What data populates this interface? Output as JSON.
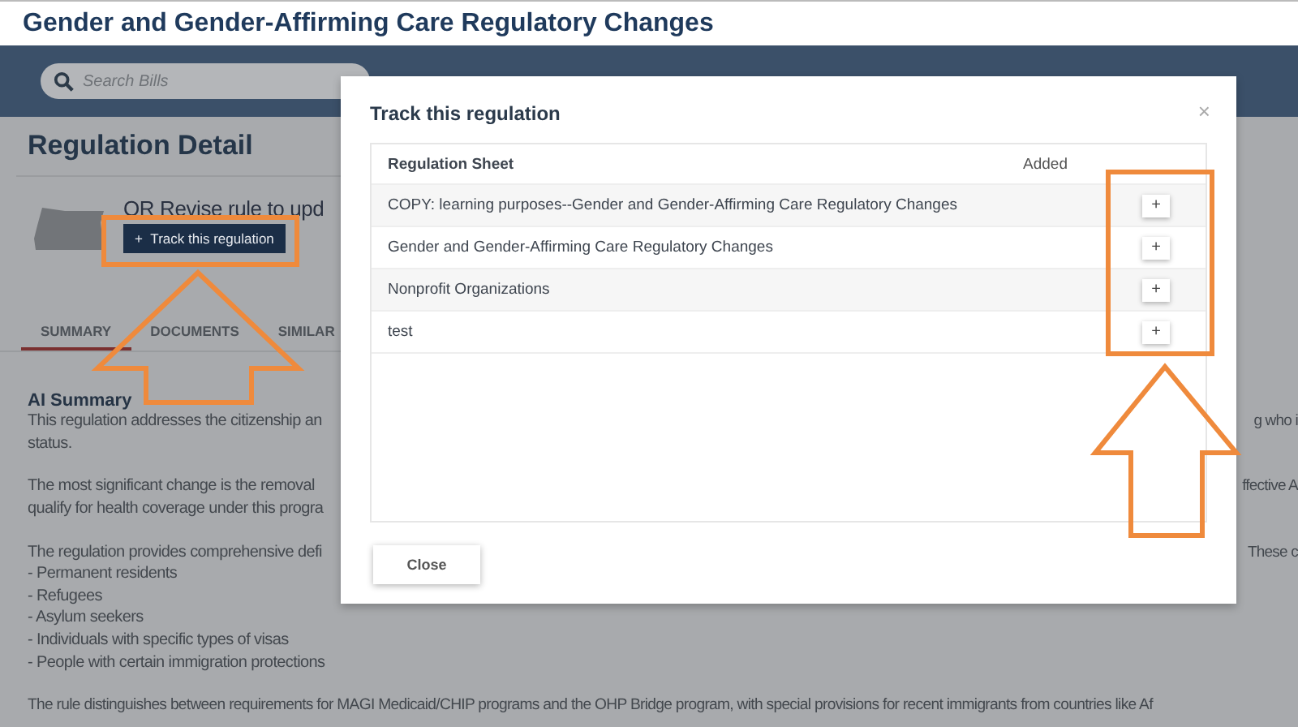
{
  "page_title": "Gender and Gender-Affirming Care Regulatory Changes",
  "header": {
    "search": {
      "placeholder": "Search Bills"
    }
  },
  "detail": {
    "heading": "Regulation Detail",
    "regulation_title": "OR Revise rule to upd",
    "track_button": {
      "icon": "+",
      "label": "Track this regulation"
    },
    "tabs": [
      {
        "label": "SUMMARY",
        "selected": true
      },
      {
        "label": "DOCUMENTS",
        "selected": false
      },
      {
        "label": "SIMILAR",
        "selected": false
      }
    ]
  },
  "summary": {
    "heading": "AI Summary",
    "paragraphs": [
      [
        {
          "text": "This regulation addresses the citizenship an",
          "tail": "g who i"
        },
        {
          "text": "status."
        }
      ],
      [
        {
          "text": "The most significant change is the removal",
          "tail": "ffective A"
        },
        {
          "text": "qualify for health coverage under this progra"
        }
      ],
      [
        {
          "text": "The regulation provides comprehensive defi",
          "tail": "These c"
        },
        {
          "text": "- Permanent residents"
        },
        {
          "text": "- Refugees"
        },
        {
          "text": "- Asylum seekers"
        },
        {
          "text": "- Individuals with specific types of visas"
        },
        {
          "text": "- People with certain immigration protections"
        }
      ],
      [
        {
          "text": "The rule distinguishes between requirements for MAGI Medicaid/CHIP programs and the OHP Bridge program, with special provisions for recent immigrants from countries like Af"
        }
      ]
    ]
  },
  "modal": {
    "title": "Track this regulation",
    "close_icon": "×",
    "columns": [
      "Regulation Sheet",
      "Added"
    ],
    "rows": [
      {
        "sheet": "COPY: learning purposes--Gender and Gender-Affirming Care Regulatory Changes",
        "add": "+"
      },
      {
        "sheet": "Gender and Gender-Affirming Care Regulatory Changes",
        "add": "+"
      },
      {
        "sheet": "Nonprofit Organizations",
        "add": "+"
      },
      {
        "sheet": "test",
        "add": "+"
      }
    ],
    "close_button": "Close"
  }
}
